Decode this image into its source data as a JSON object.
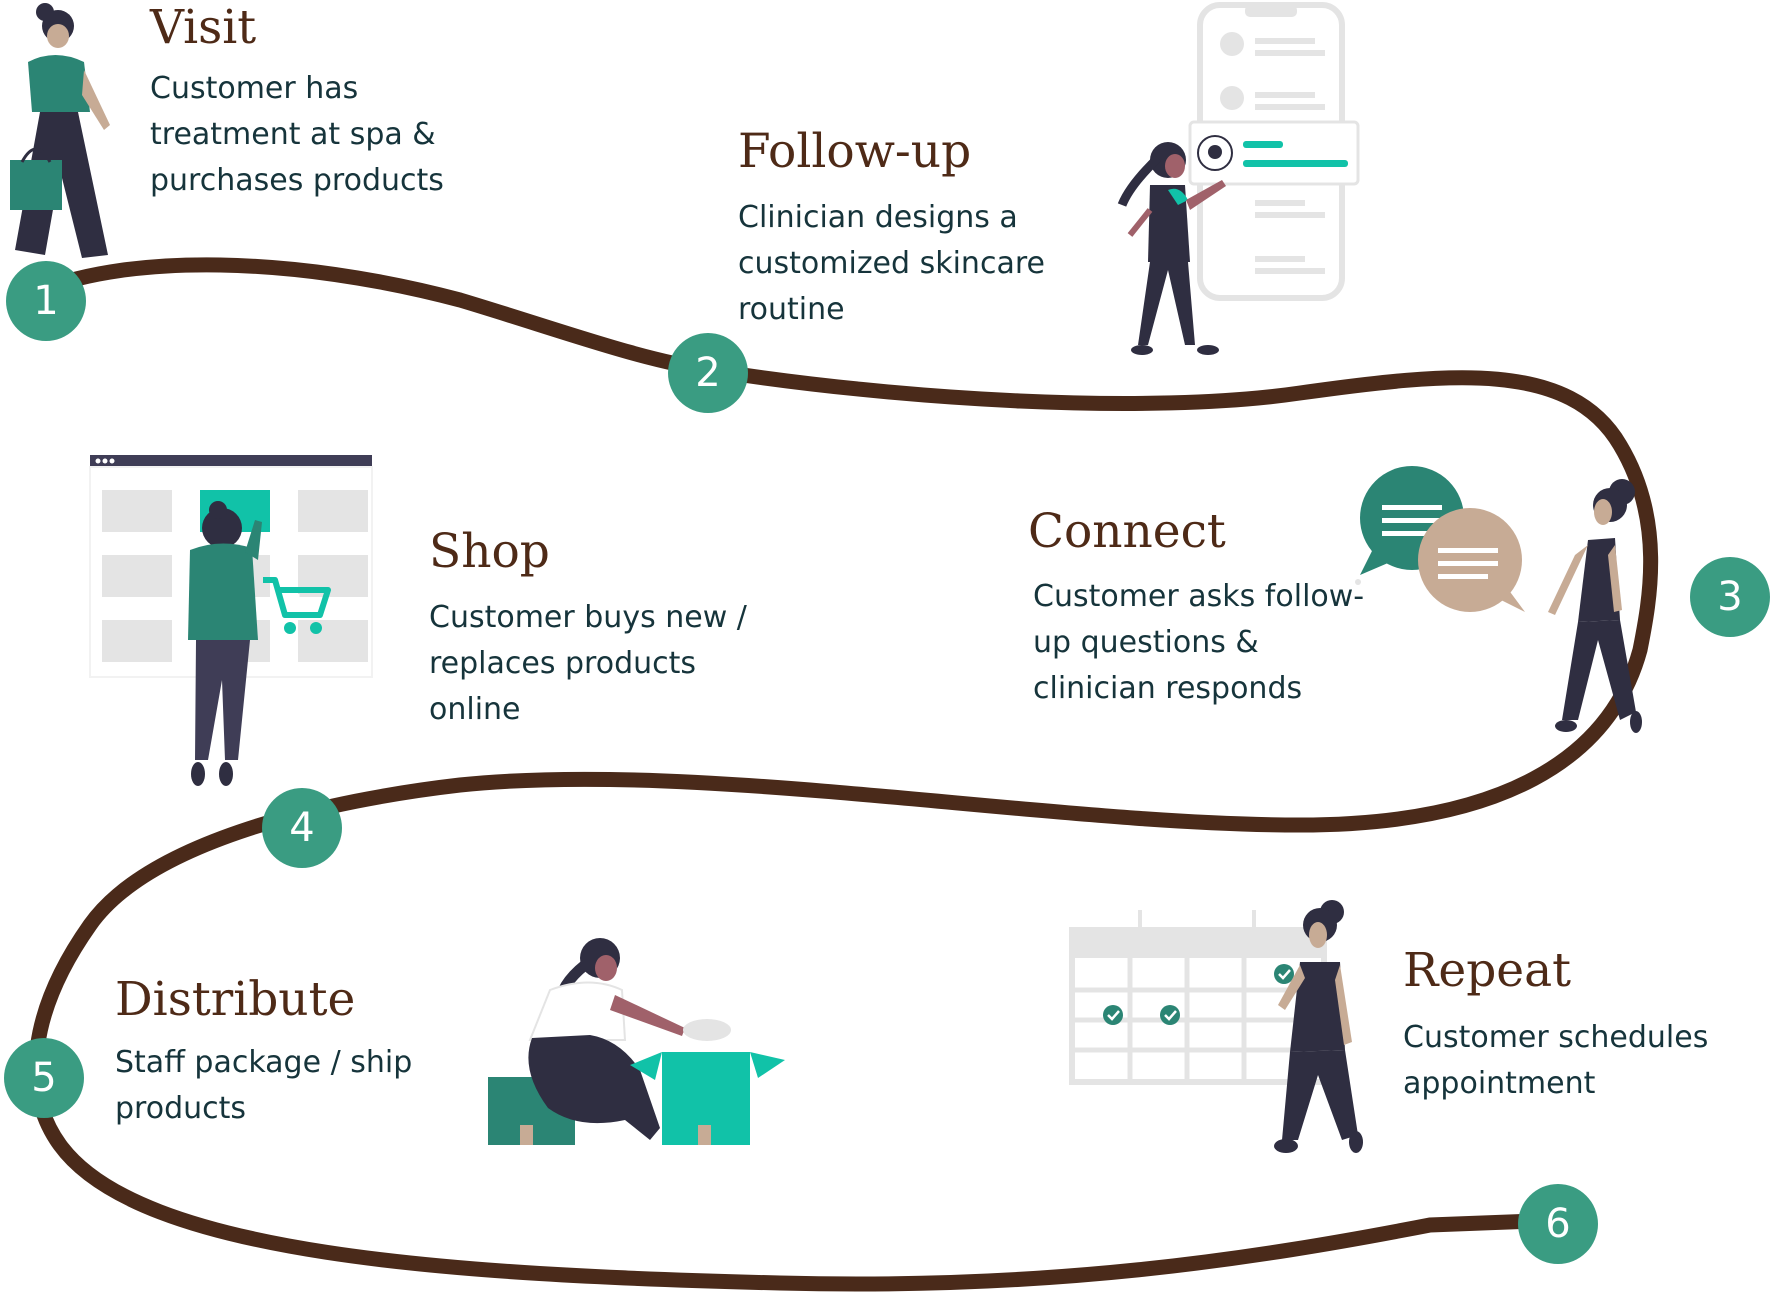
{
  "colors": {
    "path": "#4a2a1a",
    "badge": "#3a9c82",
    "teal": "#2b8574",
    "aqua": "#11c2a8",
    "dark": "#2f2e41",
    "skin": "#c7ab95",
    "skin_dark": "#a0616a",
    "hair": "#2f2e41",
    "gray": "#e4e4e4",
    "gray_mid": "#d0cde1",
    "title": "#4e2a17",
    "text": "#16343b"
  },
  "steps": [
    {
      "number": "1",
      "title": "Visit",
      "description": "Customer has\ntreatment at spa &\npurchases products"
    },
    {
      "number": "2",
      "title": "Follow-up",
      "description": "Clinician designs a\ncustomized skincare\nroutine"
    },
    {
      "number": "3",
      "title": "Connect",
      "description": "Customer asks follow-\nup questions &\nclinician responds"
    },
    {
      "number": "4",
      "title": "Shop",
      "description": "Customer buys new /\nreplaces products\nonline"
    },
    {
      "number": "5",
      "title": "Distribute",
      "description": "Staff package / ship\nproducts"
    },
    {
      "number": "6",
      "title": "Repeat",
      "description": "Customer schedules\nappointment"
    }
  ],
  "icons": [
    "shopping-woman-icon",
    "phone-profile-icon",
    "chat-bubbles-icon",
    "online-shop-icon",
    "packing-box-icon",
    "calendar-check-icon"
  ]
}
